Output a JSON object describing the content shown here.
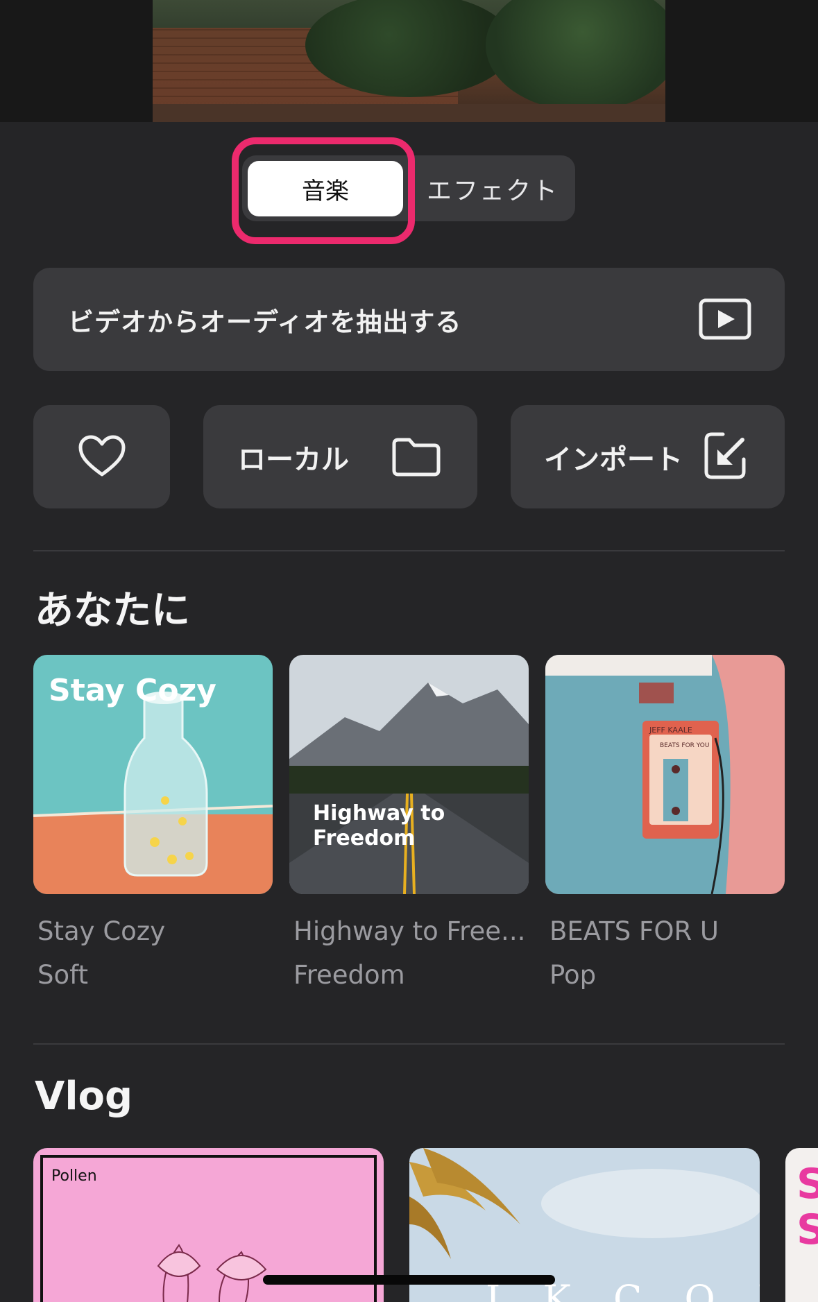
{
  "segmented": {
    "active_tab": "音楽",
    "inactive_tab": "エフェクト"
  },
  "extract": {
    "label": "ビデオからオーディオを抽出する",
    "icon": "play-screen-icon"
  },
  "quick_actions": {
    "favorites_icon": "heart-icon",
    "local_label": "ローカル",
    "local_icon": "folder-icon",
    "import_label": "インポート",
    "import_icon": "import-arrow-icon"
  },
  "for_you": {
    "title": "あなたに",
    "cards": [
      {
        "art_text": "Stay Cozy",
        "title": "Stay Cozy",
        "genre": "Soft"
      },
      {
        "art_text": "Highway to Freedom",
        "title": "Highway to Free...",
        "genre": "Freedom"
      },
      {
        "art_text": "JEFF KAALE BEATS FOR YOU",
        "title": "BEATS FOR U",
        "genre": "Pop"
      }
    ]
  },
  "vlog": {
    "title": "Vlog",
    "cards": [
      {
        "art_text": "Pollen"
      },
      {
        "art_text": ""
      },
      {
        "art_text": ""
      }
    ]
  },
  "colors": {
    "highlight": "#ec2a6d",
    "panel": "#252527",
    "tile": "#3a3a3d"
  }
}
